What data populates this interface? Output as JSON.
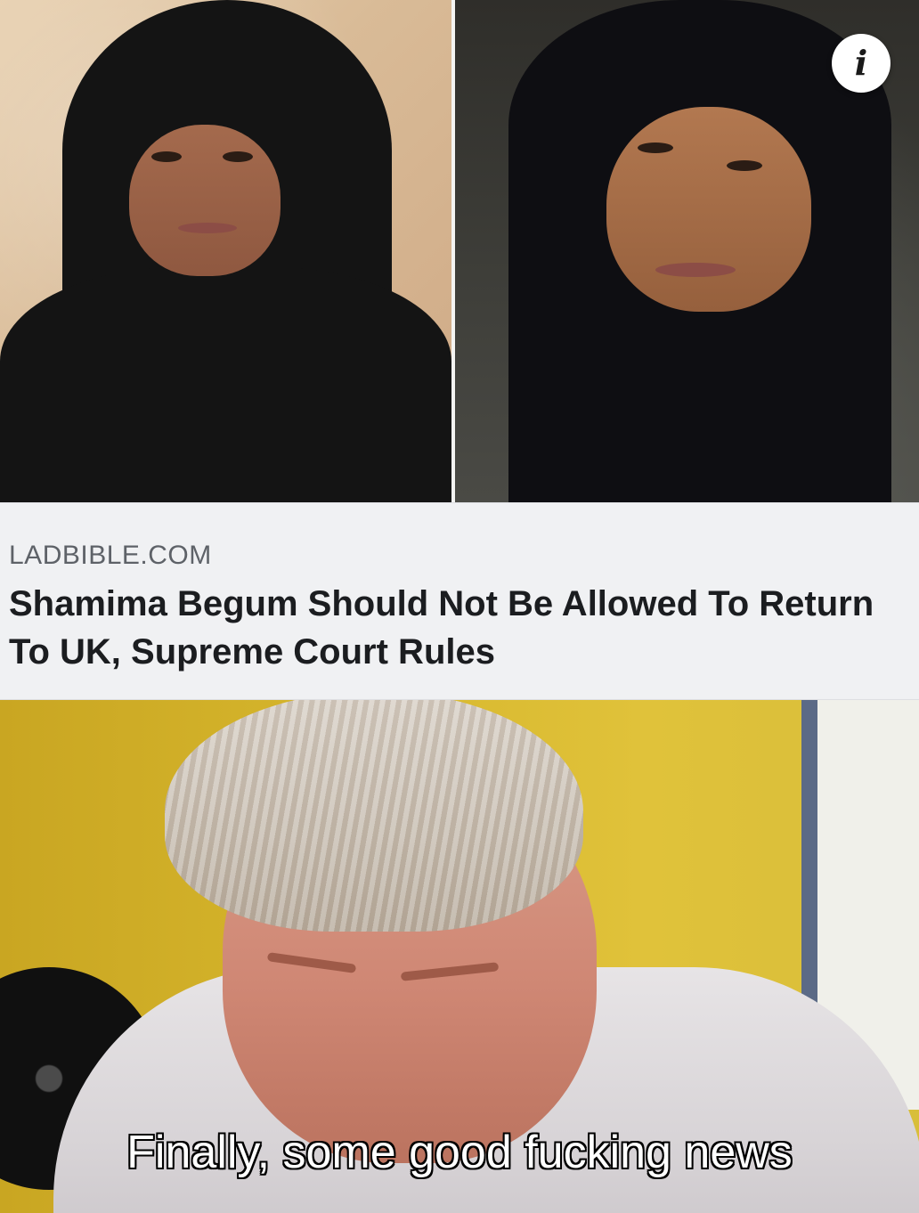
{
  "photos": {
    "left_alt": "Photo of a young woman wearing a black hijab",
    "right_alt": "Photo of a young woman wearing a black hijab"
  },
  "info_button": {
    "glyph": "i",
    "icon": "info-icon"
  },
  "link_preview": {
    "domain": "LADBIBLE.COM",
    "title": "Shamima Begum Should Not Be Allowed To Return To UK, Supreme Court Rules"
  },
  "meme": {
    "caption": "Finally, some good fucking news"
  },
  "colors": {
    "card_background": "#f0f1f3",
    "domain_text": "#5e6268",
    "title_text": "#1b1d20",
    "caption_text": "#ffffff",
    "caption_outline": "#000000"
  }
}
